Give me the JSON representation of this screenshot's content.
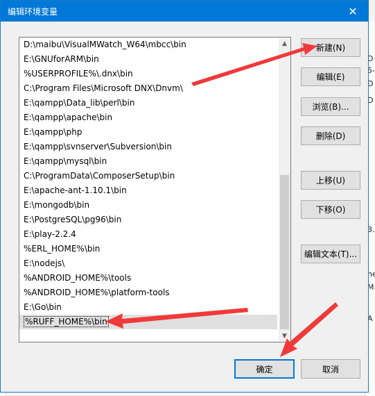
{
  "dialog": {
    "title": "编辑环境变量",
    "close_glyph": "✕"
  },
  "paths": [
    "D:\\maibu\\VisualMWatch_W64\\mbcc\\bin",
    "E:\\GNUforARM\\bin",
    "%USERPROFILE%\\.dnx\\bin",
    "C:\\Program Files\\Microsoft DNX\\Dnvm\\",
    "E:\\qampp\\Data_lib\\perl\\bin",
    "E:\\qampp\\apache\\bin",
    "E:\\qampp\\php",
    "E:\\qampp\\svnserver\\Subversion\\bin",
    "E:\\qampp\\mysql\\bin",
    "C:\\ProgramData\\ComposerSetup\\bin",
    "E:\\apache-ant-1.10.1\\bin",
    "E:\\mongodb\\bin",
    "E:\\PostgreSQL\\pg96\\bin",
    "E:\\play-2.2.4",
    "%ERL_HOME%\\bin",
    "E:\\nodejs\\",
    "%ANDROID_HOME%\\tools",
    "%ANDROID_HOME%\\platform-tools",
    "E:\\Go\\bin",
    "%RUFF_HOME%\\bin"
  ],
  "selected_index": 19,
  "buttons": {
    "new": "新建(N)",
    "edit": "编辑(E)",
    "browse": "浏览(B)...",
    "delete": "删除(D)",
    "move_up": "上移(U)",
    "move_down": "下移(O)",
    "edit_text": "编辑文本(T)...",
    "ok": "确定",
    "cancel": "取消"
  },
  "scroll": {
    "up_glyph": "▲",
    "down_glyph": "▼"
  },
  "background_fragments": [
    "D",
    "5-",
    "D",
    "D",
    "3.",
    "he",
    "M",
    "A"
  ],
  "colors": {
    "titlebar": "#0078d7",
    "annotation_arrow": "#f03a3a",
    "default_button_border": "#0078d7"
  }
}
